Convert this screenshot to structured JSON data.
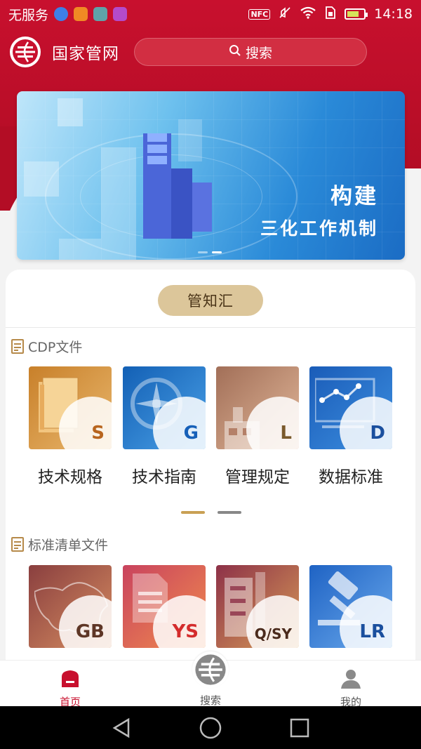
{
  "status_bar": {
    "carrier": "无服务",
    "nfc": "NFC",
    "time": "14:18"
  },
  "header": {
    "app_title": "国家管网",
    "search_label": "搜索"
  },
  "banner": {
    "line1": "构建",
    "line2": "三化工作机制",
    "slide_count": 2,
    "active_slide": 1
  },
  "main": {
    "category_chip": "管知汇",
    "sections": [
      {
        "title": "CDP文件",
        "tiles": [
          {
            "code": "S",
            "label": "技术规格",
            "icon": "book-icon"
          },
          {
            "code": "G",
            "label": "技术指南",
            "icon": "compass-icon"
          },
          {
            "code": "L",
            "label": "管理规定",
            "icon": "building-icon"
          },
          {
            "code": "D",
            "label": "数据标准",
            "icon": "monitor-chart-icon"
          }
        ]
      },
      {
        "title": "标准清单文件",
        "tiles": [
          {
            "code": "GB",
            "label": "",
            "icon": "map-icon"
          },
          {
            "code": "YS",
            "label": "",
            "icon": "document-icon"
          },
          {
            "code": "Q/SY",
            "label": "",
            "icon": "office-building-icon"
          },
          {
            "code": "LR",
            "label": "",
            "icon": "gavel-icon"
          }
        ]
      }
    ],
    "pager": {
      "pages": 2,
      "active": 0
    }
  },
  "bottom_nav": {
    "items": [
      {
        "label": "首页",
        "icon": "home-icon",
        "active": true
      },
      {
        "label": "搜索",
        "icon": "logo-icon",
        "active": false
      },
      {
        "label": "我的",
        "icon": "person-icon",
        "active": false
      }
    ]
  },
  "colors": {
    "brand_red": "#c8102e",
    "chip_gold": "#dcc69a",
    "pager_active": "#c9a054"
  }
}
